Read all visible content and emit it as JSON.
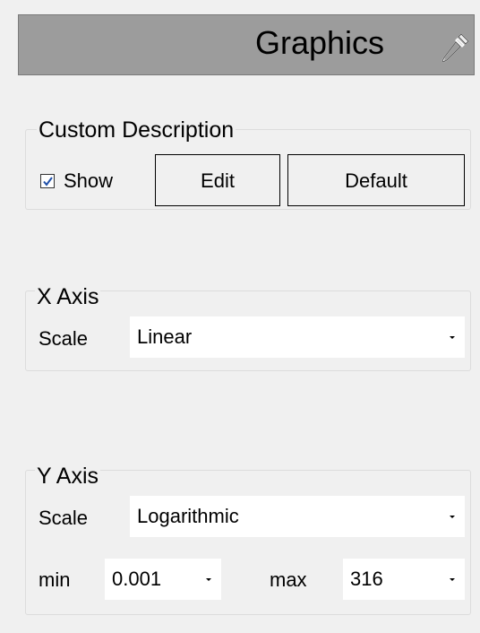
{
  "header": {
    "title": "Graphics",
    "icon": "eyedropper-icon"
  },
  "custom_description": {
    "title": "Custom Description",
    "show_label": "Show",
    "show_checked": true,
    "edit_label": "Edit",
    "default_label": "Default"
  },
  "x_axis": {
    "title": "X Axis",
    "scale_label": "Scale",
    "scale_value": "Linear"
  },
  "y_axis": {
    "title": "Y Axis",
    "scale_label": "Scale",
    "scale_value": "Logarithmic",
    "min_label": "min",
    "min_value": "0.001",
    "max_label": "max",
    "max_value": "316"
  }
}
